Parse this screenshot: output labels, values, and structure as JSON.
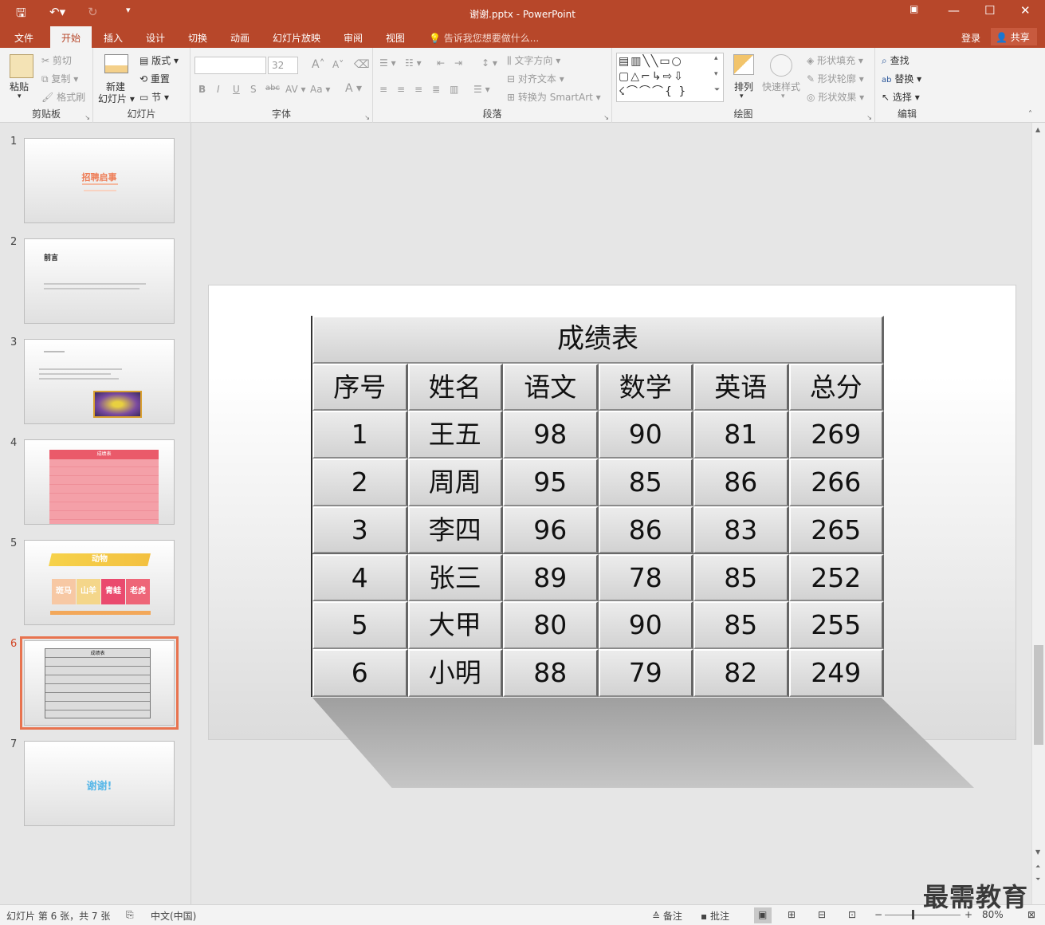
{
  "window": {
    "title": "谢谢.pptx - PowerPoint"
  },
  "tabs": [
    {
      "label": "文件"
    },
    {
      "label": "开始"
    },
    {
      "label": "插入"
    },
    {
      "label": "设计"
    },
    {
      "label": "切换"
    },
    {
      "label": "动画"
    },
    {
      "label": "幻灯片放映"
    },
    {
      "label": "审阅"
    },
    {
      "label": "视图"
    }
  ],
  "tell_me": "告诉我您想要做什么...",
  "account": {
    "login": "登录",
    "share": "共享"
  },
  "ribbon": {
    "clipboard": {
      "paste": "粘贴",
      "cut": "剪切",
      "copy": "复制",
      "format_painter": "格式刷",
      "label": "剪贴板"
    },
    "slides": {
      "new_slide_1": "新建",
      "new_slide_2": "幻灯片",
      "layout": "版式",
      "reset": "重置",
      "section": "节",
      "label": "幻灯片"
    },
    "font": {
      "font_size": "32",
      "label": "字体"
    },
    "paragraph": {
      "text_direction": "文字方向",
      "align_text": "对齐文本",
      "smartart": "转换为 SmartArt",
      "label": "段落"
    },
    "drawing": {
      "arrange": "排列",
      "quick_styles": "快速样式",
      "shape_fill": "形状填充",
      "shape_outline": "形状轮廓",
      "shape_effects": "形状效果",
      "label": "绘图"
    },
    "editing": {
      "find": "查找",
      "replace": "替换",
      "select": "选择",
      "label": "编辑"
    }
  },
  "thumbnails": [
    {
      "num": "1",
      "title": "招聘启事"
    },
    {
      "num": "2",
      "title": "前言"
    },
    {
      "num": "3"
    },
    {
      "num": "4",
      "title": "成绩表"
    },
    {
      "num": "5",
      "title": "动物",
      "tiles": [
        "斑马",
        "山羊",
        "青蛙",
        "老虎"
      ]
    },
    {
      "num": "6",
      "title": "成绩表"
    },
    {
      "num": "7",
      "title": "谢谢!"
    }
  ],
  "slide_table": {
    "title": "成绩表",
    "headers": [
      "序号",
      "姓名",
      "语文",
      "数学",
      "英语",
      "总分"
    ],
    "rows": [
      [
        "1",
        "王五",
        "98",
        "90",
        "81",
        "269"
      ],
      [
        "2",
        "周周",
        "95",
        "85",
        "86",
        "266"
      ],
      [
        "3",
        "李四",
        "96",
        "86",
        "83",
        "265"
      ],
      [
        "4",
        "张三",
        "89",
        "78",
        "85",
        "252"
      ],
      [
        "5",
        "大甲",
        "80",
        "90",
        "85",
        "255"
      ],
      [
        "6",
        "小明",
        "88",
        "79",
        "82",
        "249"
      ]
    ]
  },
  "status": {
    "slide_info": "幻灯片 第 6 张，共 7 张",
    "language": "中文(中国)",
    "notes": "备注",
    "comments": "批注",
    "zoom": "80%"
  },
  "watermark": "最需教育",
  "colors": {
    "accent": "#b7472a",
    "selected_thumb": "#e8734f"
  }
}
